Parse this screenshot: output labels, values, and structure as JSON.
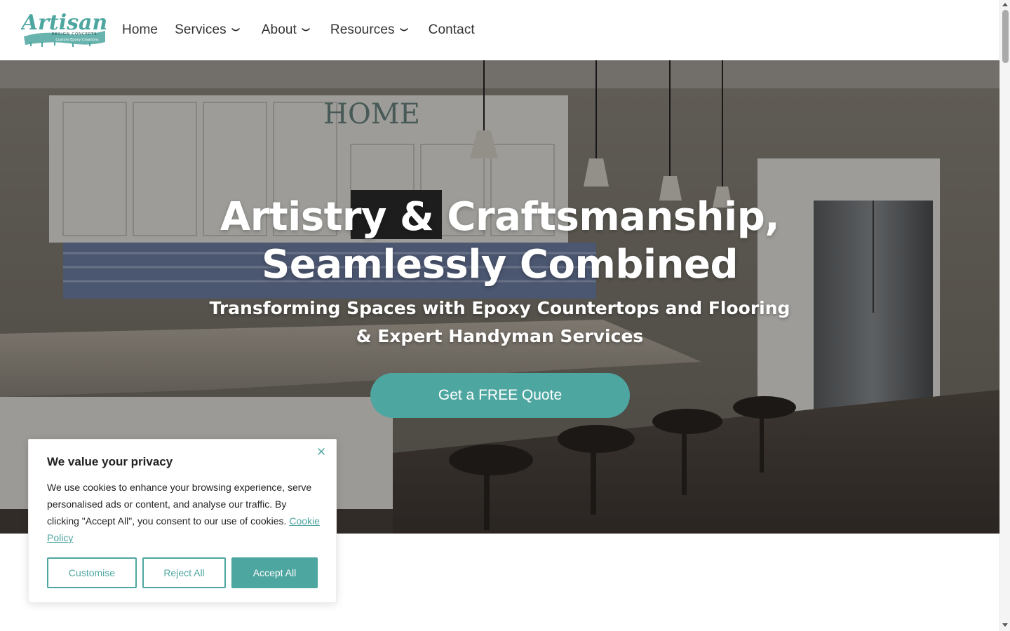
{
  "brand": {
    "logo_main": "Artisan",
    "logo_line2": "DESIGN CONCEPTS",
    "logo_line3": "Custom Epoxy Creations",
    "accent_color": "#4ea6a0"
  },
  "nav": {
    "items": [
      {
        "label": "Home",
        "has_dropdown": false
      },
      {
        "label": "Services",
        "has_dropdown": true
      },
      {
        "label": "About",
        "has_dropdown": true
      },
      {
        "label": "Resources",
        "has_dropdown": true
      },
      {
        "label": "Contact",
        "has_dropdown": false
      }
    ]
  },
  "hero": {
    "title_line1": "Artistry & Craftsmanship,",
    "title_line2": "Seamlessly Combined",
    "subtitle_line1": "Transforming Spaces with Epoxy Countertops and Flooring",
    "subtitle_line2": "& Expert Handyman Services",
    "cta_label": "Get a FREE Quote"
  },
  "cookie_banner": {
    "title": "We value your privacy",
    "body": "We use cookies to enhance your browsing experience, serve personalised ads or content, and analyse our traffic. By clicking \"Accept All\", you consent to our use of cookies.",
    "link_label": "Cookie Policy",
    "customise_label": "Customise",
    "reject_label": "Reject All",
    "accept_label": "Accept All",
    "close_icon": "close-icon"
  }
}
